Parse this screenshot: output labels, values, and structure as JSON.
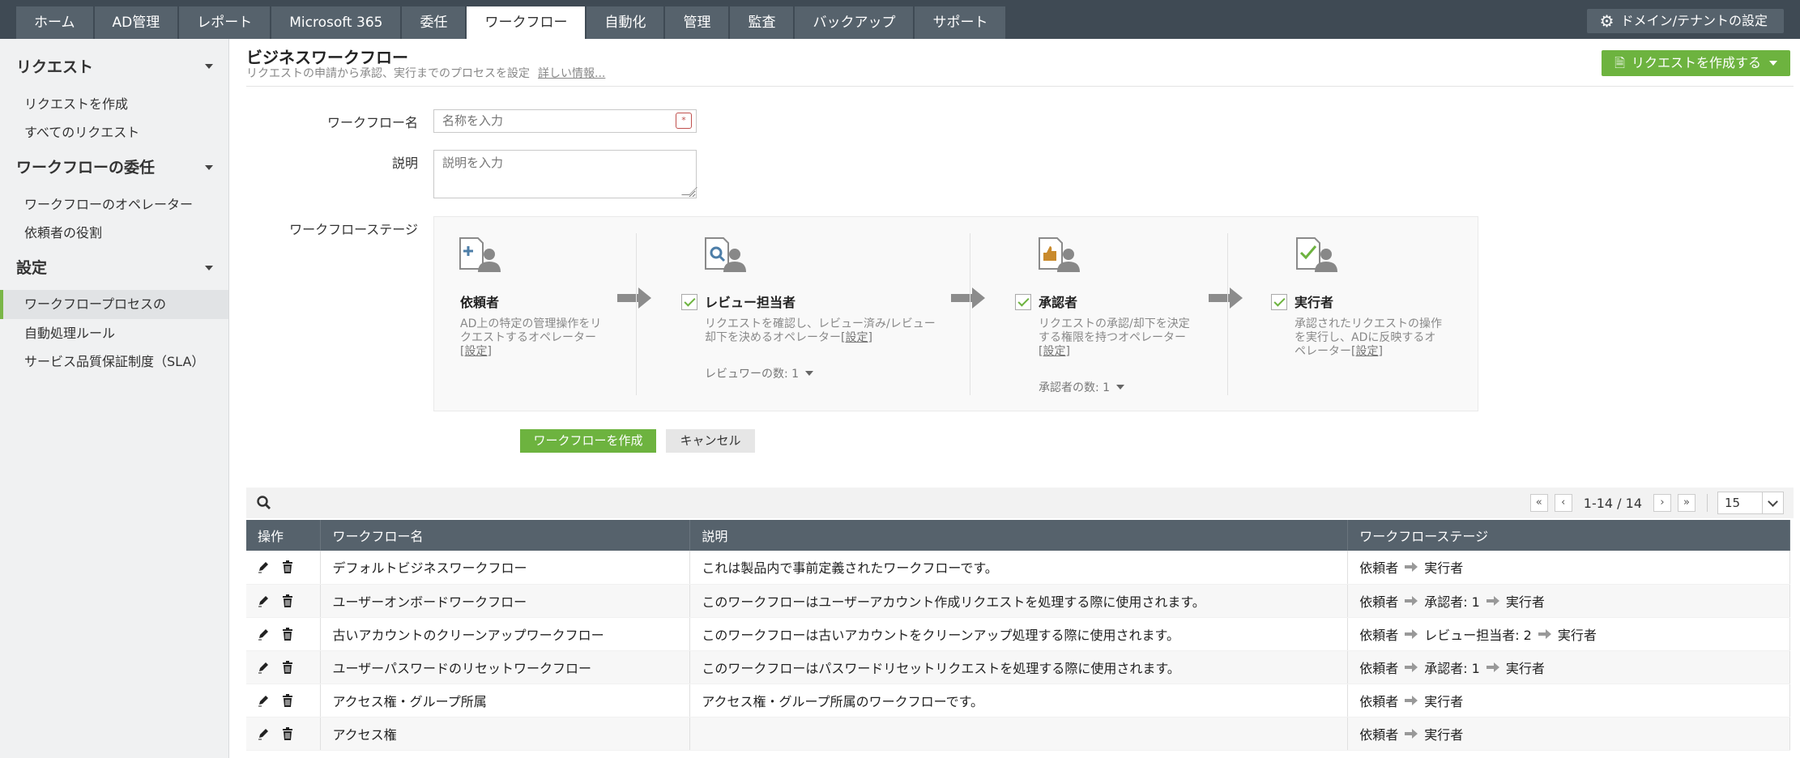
{
  "nav": {
    "tabs": [
      "ホーム",
      "AD管理",
      "レポート",
      "Microsoft 365",
      "委任",
      "ワークフロー",
      "自動化",
      "管理",
      "監査",
      "バックアップ",
      "サポート"
    ],
    "active_tab": "ワークフロー",
    "domain_button": "ドメイン/テナントの設定"
  },
  "sidebar": {
    "sections": [
      {
        "title": "リクエスト",
        "items": [
          "リクエストを作成",
          "すべてのリクエスト"
        ]
      },
      {
        "title": "ワークフローの委任",
        "items": [
          "ワークフローのオペレーター",
          "依頼者の役割"
        ]
      },
      {
        "title": "設定",
        "items": [
          "ワークフロープロセスの",
          "自動処理ルール",
          "サービス品質保証制度（SLA）"
        ]
      }
    ],
    "active_item": "ワークフロープロセスの"
  },
  "header": {
    "title": "ビジネスワークフロー",
    "subtitle": "リクエストの申請から承認、実行までのプロセスを設定",
    "more_link": "詳しい情報...",
    "create_request": "リクエストを作成する"
  },
  "form": {
    "name_label": "ワークフロー名",
    "name_placeholder": "名称を入力",
    "desc_label": "説明",
    "desc_placeholder": "説明を入力",
    "stages_label": "ワークフローステージ",
    "stages": [
      {
        "title": "依頼者",
        "desc": "AD上の特定の管理操作をリクエストするオペレーター",
        "link": "[設定]",
        "checkbox": false,
        "count": ""
      },
      {
        "title": "レビュー担当者",
        "desc": "リクエストを確認し、レビュー済み/レビュー却下を決めるオペレーター",
        "link": "[設定]",
        "checkbox": true,
        "count": "レビュワーの数: 1"
      },
      {
        "title": "承認者",
        "desc": "リクエストの承認/却下を決定する権限を持つオペレーター",
        "link": "[設定]",
        "checkbox": true,
        "count": "承認者の数: 1"
      },
      {
        "title": "実行者",
        "desc": "承認されたリクエストの操作を実行し、ADに反映するオペレーター",
        "link": "[設定]",
        "checkbox": true,
        "count": ""
      }
    ],
    "create_button": "ワークフローを作成",
    "cancel_button": "キャンセル"
  },
  "pager": {
    "range": "1-14 / 14",
    "page_size": "15"
  },
  "table": {
    "columns": [
      "操作",
      "ワークフロー名",
      "説明",
      "ワークフローステージ"
    ],
    "rows": [
      {
        "name": "デフォルトビジネスワークフロー",
        "desc": "これは製品内で事前定義されたワークフローです。",
        "stages": [
          "依頼者",
          "実行者"
        ]
      },
      {
        "name": "ユーザーオンボードワークフロー",
        "desc": "このワークフローはユーザーアカウント作成リクエストを処理する際に使用されます。",
        "stages": [
          "依頼者",
          "承認者: 1",
          "実行者"
        ]
      },
      {
        "name": "古いアカウントのクリーンアップワークフロー",
        "desc": "このワークフローは古いアカウントをクリーンアップ処理する際に使用されます。",
        "stages": [
          "依頼者",
          "レビュー担当者: 2",
          "実行者"
        ]
      },
      {
        "name": "ユーザーパスワードのリセットワークフロー",
        "desc": "このワークフローはパスワードリセットリクエストを処理する際に使用されます。",
        "stages": [
          "依頼者",
          "承認者: 1",
          "実行者"
        ]
      },
      {
        "name": "アクセス権・グループ所属",
        "desc": "アクセス権・グループ所属のワークフローです。",
        "stages": [
          "依頼者",
          "実行者"
        ]
      },
      {
        "name": "アクセス権",
        "desc": "",
        "stages": [
          "依頼者",
          "実行者"
        ]
      }
    ]
  },
  "colors": {
    "accent": "#6db33f",
    "nav": "#3f4a54",
    "tab": "#56626c"
  }
}
